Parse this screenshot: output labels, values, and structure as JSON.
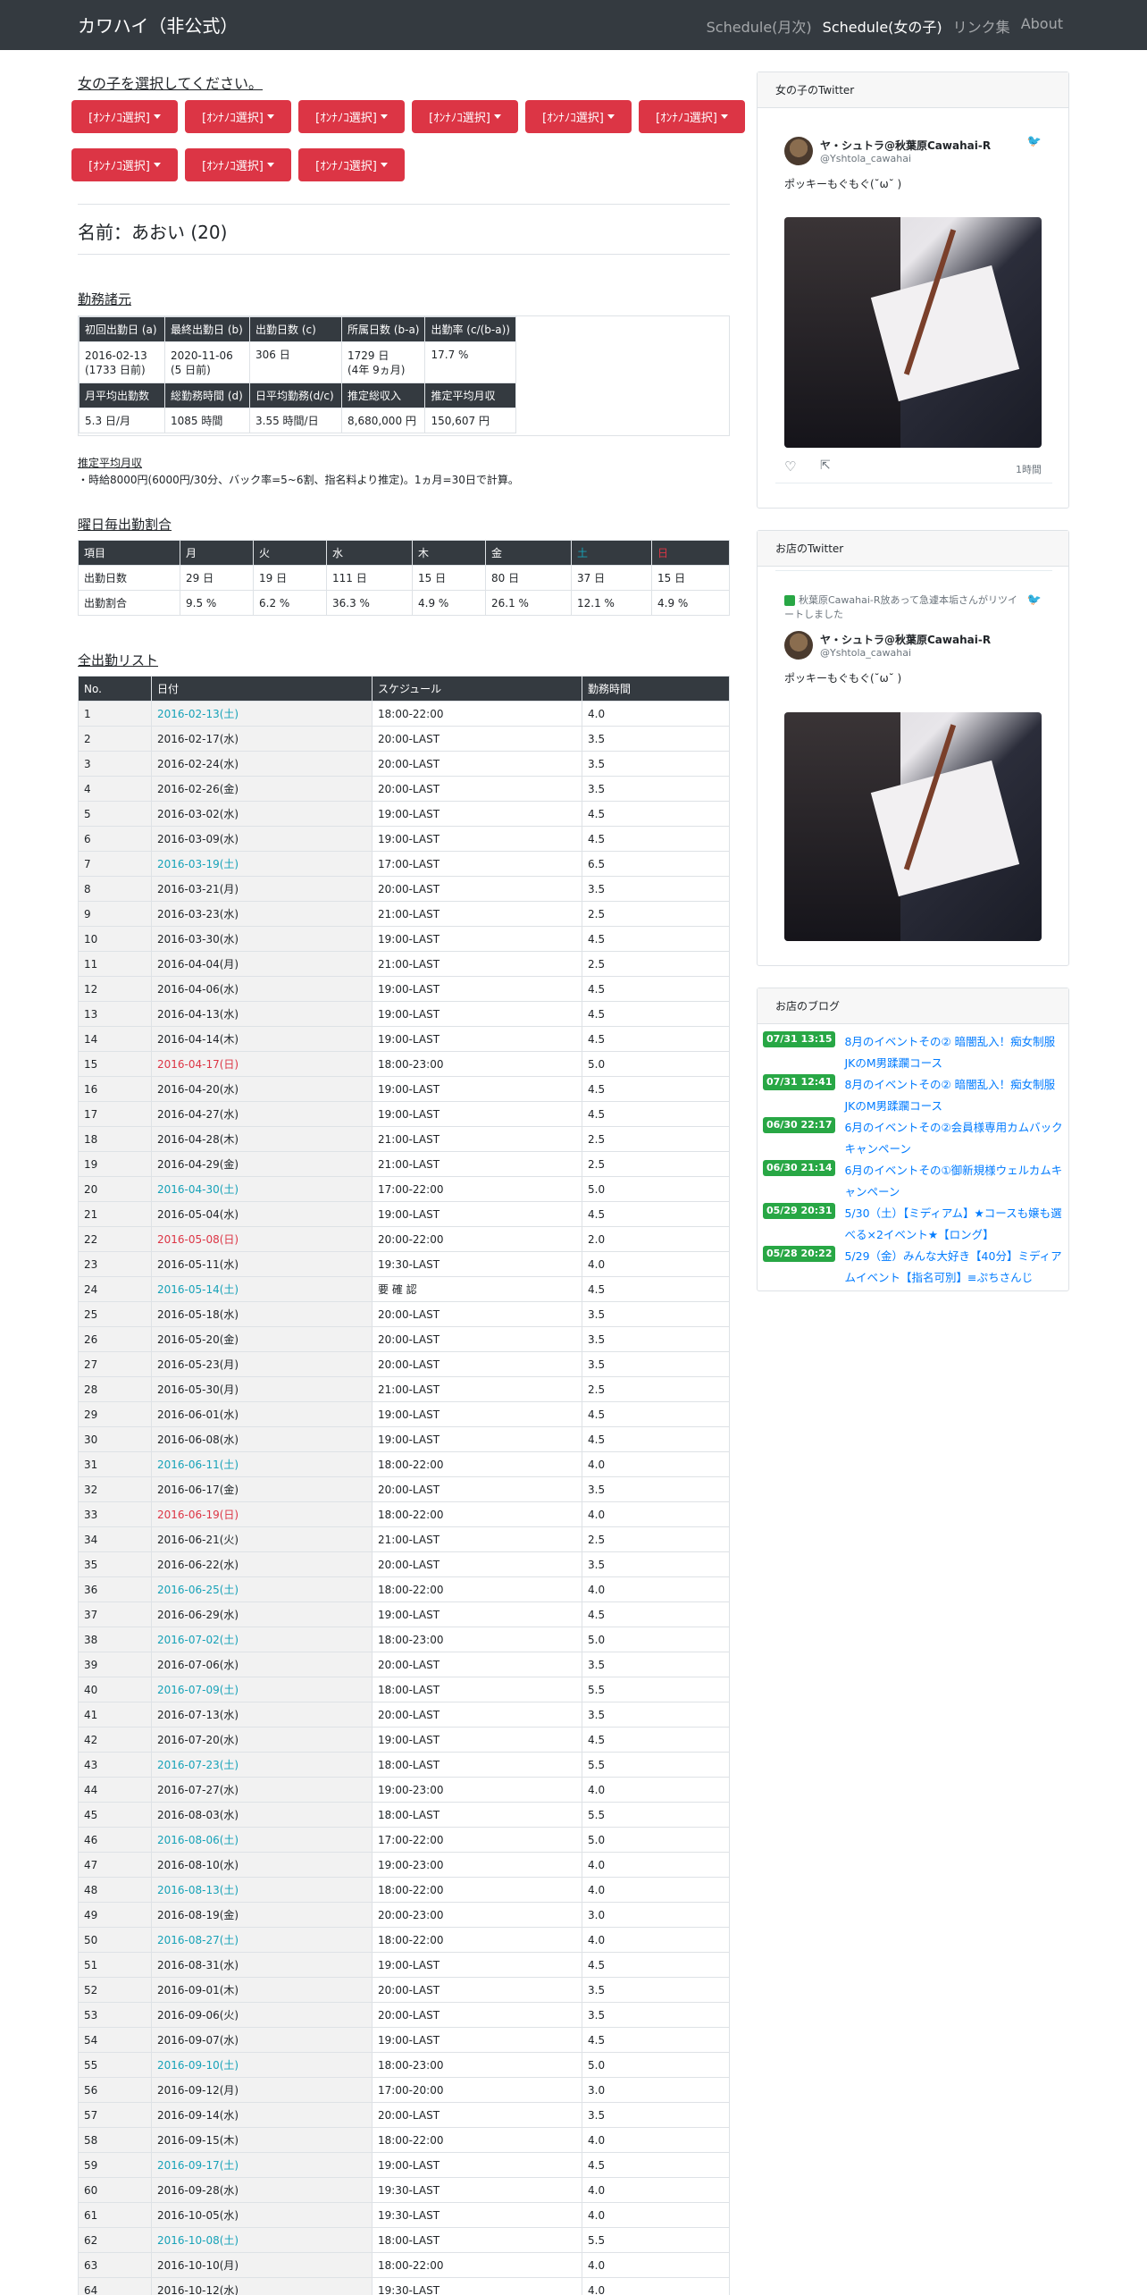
{
  "nav": {
    "brand": "カワハイ（非公式）",
    "links": [
      {
        "label": "Schedule(月次)",
        "active": false
      },
      {
        "label": "Schedule(女の子)",
        "active": true
      },
      {
        "label": "リンク集",
        "active": false
      },
      {
        "label": "About",
        "active": false
      }
    ]
  },
  "selector": {
    "title": "女の子を選択してください。",
    "buttons": [
      "[ｵﾝﾅﾉｺ選択]",
      "[ｵﾝﾅﾉｺ選択]",
      "[ｵﾝﾅﾉｺ選択]",
      "[ｵﾝﾅﾉｺ選択]",
      "[ｵﾝﾅﾉｺ選択]",
      "[ｵﾝﾅﾉｺ選択]",
      "[ｵﾝﾅﾉｺ選択]",
      "[ｵﾝﾅﾉｺ選択]",
      "[ｵﾝﾅﾉｺ選択]"
    ]
  },
  "profile": {
    "name": "名前：あおい (20)"
  },
  "stats": {
    "title": "勤務諸元",
    "headers1": [
      "初回出勤日 (a)",
      "最終出勤日 (b)",
      "出勤日数 (c)",
      "所属日数 (b-a)",
      "出勤率 (c/(b-a))"
    ],
    "row1": [
      [
        "2016-02-13",
        "(1733 日前)"
      ],
      [
        "2020-11-06",
        "(5 日前)"
      ],
      [
        "306 日",
        ""
      ],
      [
        "1729 日",
        "(4年 9ヵ月)"
      ],
      [
        "17.7 %",
        ""
      ]
    ],
    "headers2": [
      "月平均出勤数",
      "総勤務時間 (d)",
      "日平均勤務(d/c)",
      "推定総収入",
      "推定平均月収"
    ],
    "row2": [
      "5.3 日/月",
      "1085 時間",
      "3.55 時間/日",
      "8,680,000 円",
      "150,607 円"
    ]
  },
  "note": {
    "title": "推定平均月収",
    "text": "・時給8000円(6000円/30分、バック率=5~6割、指名料より推定)。1ヵ月=30日で計算。"
  },
  "weekly": {
    "title": "曜日毎出勤割合",
    "headers": [
      "項目",
      "月",
      "火",
      "水",
      "木",
      "金",
      "土",
      "日"
    ],
    "rows": [
      [
        "出勤日数",
        "29 日",
        "19 日",
        "111 日",
        "15 日",
        "80 日",
        "37 日",
        "15 日"
      ],
      [
        "出勤割合",
        "9.5 %",
        "6.2 %",
        "36.3 %",
        "4.9 %",
        "26.1 %",
        "12.1 %",
        "4.9 %"
      ]
    ],
    "colors": {
      "sat": "#17a2b8",
      "sun": "#dc3545"
    }
  },
  "attendance": {
    "title": "全出勤リスト",
    "headers": [
      "No.",
      "日付",
      "スケジュール",
      "勤務時間"
    ],
    "rows": [
      [
        "1",
        "2016-02-13(土)",
        "18:00-22:00",
        "4.0",
        "sat"
      ],
      [
        "2",
        "2016-02-17(水)",
        "20:00-LAST",
        "3.5",
        ""
      ],
      [
        "3",
        "2016-02-24(水)",
        "20:00-LAST",
        "3.5",
        ""
      ],
      [
        "4",
        "2016-02-26(金)",
        "20:00-LAST",
        "3.5",
        ""
      ],
      [
        "5",
        "2016-03-02(水)",
        "19:00-LAST",
        "4.5",
        ""
      ],
      [
        "6",
        "2016-03-09(水)",
        "19:00-LAST",
        "4.5",
        ""
      ],
      [
        "7",
        "2016-03-19(土)",
        "17:00-LAST",
        "6.5",
        "sat"
      ],
      [
        "8",
        "2016-03-21(月)",
        "20:00-LAST",
        "3.5",
        ""
      ],
      [
        "9",
        "2016-03-23(水)",
        "21:00-LAST",
        "2.5",
        ""
      ],
      [
        "10",
        "2016-03-30(水)",
        "19:00-LAST",
        "4.5",
        ""
      ],
      [
        "11",
        "2016-04-04(月)",
        "21:00-LAST",
        "2.5",
        ""
      ],
      [
        "12",
        "2016-04-06(水)",
        "19:00-LAST",
        "4.5",
        ""
      ],
      [
        "13",
        "2016-04-13(水)",
        "19:00-LAST",
        "4.5",
        ""
      ],
      [
        "14",
        "2016-04-14(木)",
        "19:00-LAST",
        "4.5",
        ""
      ],
      [
        "15",
        "2016-04-17(日)",
        "18:00-23:00",
        "5.0",
        "sun"
      ],
      [
        "16",
        "2016-04-20(水)",
        "19:00-LAST",
        "4.5",
        ""
      ],
      [
        "17",
        "2016-04-27(水)",
        "19:00-LAST",
        "4.5",
        ""
      ],
      [
        "18",
        "2016-04-28(木)",
        "21:00-LAST",
        "2.5",
        ""
      ],
      [
        "19",
        "2016-04-29(金)",
        "21:00-LAST",
        "2.5",
        ""
      ],
      [
        "20",
        "2016-04-30(土)",
        "17:00-22:00",
        "5.0",
        "sat"
      ],
      [
        "21",
        "2016-05-04(水)",
        "19:00-LAST",
        "4.5",
        ""
      ],
      [
        "22",
        "2016-05-08(日)",
        "20:00-22:00",
        "2.0",
        "sun"
      ],
      [
        "23",
        "2016-05-11(水)",
        "19:30-LAST",
        "4.0",
        ""
      ],
      [
        "24",
        "2016-05-14(土)",
        "要 確 認",
        "4.5",
        "sat"
      ],
      [
        "25",
        "2016-05-18(水)",
        "20:00-LAST",
        "3.5",
        ""
      ],
      [
        "26",
        "2016-05-20(金)",
        "20:00-LAST",
        "3.5",
        ""
      ],
      [
        "27",
        "2016-05-23(月)",
        "20:00-LAST",
        "3.5",
        ""
      ],
      [
        "28",
        "2016-05-30(月)",
        "21:00-LAST",
        "2.5",
        ""
      ],
      [
        "29",
        "2016-06-01(水)",
        "19:00-LAST",
        "4.5",
        ""
      ],
      [
        "30",
        "2016-06-08(水)",
        "19:00-LAST",
        "4.5",
        ""
      ],
      [
        "31",
        "2016-06-11(土)",
        "18:00-22:00",
        "4.0",
        "sat"
      ],
      [
        "32",
        "2016-06-17(金)",
        "20:00-LAST",
        "3.5",
        ""
      ],
      [
        "33",
        "2016-06-19(日)",
        "18:00-22:00",
        "4.0",
        "sun"
      ],
      [
        "34",
        "2016-06-21(火)",
        "21:00-LAST",
        "2.5",
        ""
      ],
      [
        "35",
        "2016-06-22(水)",
        "20:00-LAST",
        "3.5",
        ""
      ],
      [
        "36",
        "2016-06-25(土)",
        "18:00-22:00",
        "4.0",
        "sat"
      ],
      [
        "37",
        "2016-06-29(水)",
        "19:00-LAST",
        "4.5",
        ""
      ],
      [
        "38",
        "2016-07-02(土)",
        "18:00-23:00",
        "5.0",
        "sat"
      ],
      [
        "39",
        "2016-07-06(水)",
        "20:00-LAST",
        "3.5",
        ""
      ],
      [
        "40",
        "2016-07-09(土)",
        "18:00-LAST",
        "5.5",
        "sat"
      ],
      [
        "41",
        "2016-07-13(水)",
        "20:00-LAST",
        "3.5",
        ""
      ],
      [
        "42",
        "2016-07-20(水)",
        "19:00-LAST",
        "4.5",
        ""
      ],
      [
        "43",
        "2016-07-23(土)",
        "18:00-LAST",
        "5.5",
        "sat"
      ],
      [
        "44",
        "2016-07-27(水)",
        "19:00-23:00",
        "4.0",
        ""
      ],
      [
        "45",
        "2016-08-03(水)",
        "18:00-LAST",
        "5.5",
        ""
      ],
      [
        "46",
        "2016-08-06(土)",
        "17:00-22:00",
        "5.0",
        "sat"
      ],
      [
        "47",
        "2016-08-10(水)",
        "19:00-23:00",
        "4.0",
        ""
      ],
      [
        "48",
        "2016-08-13(土)",
        "18:00-22:00",
        "4.0",
        "sat"
      ],
      [
        "49",
        "2016-08-19(金)",
        "20:00-23:00",
        "3.0",
        ""
      ],
      [
        "50",
        "2016-08-27(土)",
        "18:00-22:00",
        "4.0",
        "sat"
      ],
      [
        "51",
        "2016-08-31(水)",
        "19:00-LAST",
        "4.5",
        ""
      ],
      [
        "52",
        "2016-09-01(木)",
        "20:00-LAST",
        "3.5",
        ""
      ],
      [
        "53",
        "2016-09-06(火)",
        "20:00-LAST",
        "3.5",
        ""
      ],
      [
        "54",
        "2016-09-07(水)",
        "19:00-LAST",
        "4.5",
        ""
      ],
      [
        "55",
        "2016-09-10(土)",
        "18:00-23:00",
        "5.0",
        "sat"
      ],
      [
        "56",
        "2016-09-12(月)",
        "17:00-20:00",
        "3.0",
        ""
      ],
      [
        "57",
        "2016-09-14(水)",
        "20:00-LAST",
        "3.5",
        ""
      ],
      [
        "58",
        "2016-09-15(木)",
        "18:00-22:00",
        "4.0",
        ""
      ],
      [
        "59",
        "2016-09-17(土)",
        "19:00-LAST",
        "4.5",
        "sat"
      ],
      [
        "60",
        "2016-09-28(水)",
        "19:30-LAST",
        "4.0",
        ""
      ],
      [
        "61",
        "2016-10-05(水)",
        "19:30-LAST",
        "4.0",
        ""
      ],
      [
        "62",
        "2016-10-08(土)",
        "18:00-LAST",
        "5.5",
        "sat"
      ],
      [
        "63",
        "2016-10-10(月)",
        "18:00-22:00",
        "4.0",
        ""
      ],
      [
        "64",
        "2016-10-12(水)",
        "19:30-LAST",
        "4.0",
        ""
      ]
    ]
  },
  "twitter_girl": {
    "title": "女の子のTwitter",
    "name": "ヤ・シュトラ@秋葉原Cawahai-R",
    "handle": "@Yshtola_cawahai",
    "text": "ポッキーもぐもぐ(˘ω˘ )",
    "time": "1時間",
    "bird_icon": "twitter-bird-icon"
  },
  "twitter_shop": {
    "title": "お店のTwitter",
    "retweet": "秋葉原Cawahai-R放あって急遽本垢さんがリツイートしました",
    "name": "ヤ・シュトラ@秋葉原Cawahai-R",
    "handle": "@Yshtola_cawahai",
    "text": "ポッキーもぐもぐ(˘ω˘ )"
  },
  "blog": {
    "title": "お店のブログ",
    "items": [
      {
        "time": "07/31 13:15",
        "text": "8月のイベントその② 暗闇乱入！痴女制服JKのM男蹂躙コース"
      },
      {
        "time": "07/31 12:41",
        "text": "8月のイベントその② 暗闇乱入！痴女制服JKのM男蹂躙コース"
      },
      {
        "time": "06/30 22:17",
        "text": "6月のイベントその②会員様専用カムバックキャンペーン"
      },
      {
        "time": "06/30 21:14",
        "text": "6月のイベントその①御新規様ウェルカムキャンペーン"
      },
      {
        "time": "05/29 20:31",
        "text": "5/30（土）【ミディアム】★コースも嬢も選べる×2イベント★【ロング】"
      },
      {
        "time": "05/28 20:22",
        "text": "5/29（金）みんな大好き【40分】ミディアムイベント【指名可別】≡ぷちさんじ"
      }
    ]
  }
}
